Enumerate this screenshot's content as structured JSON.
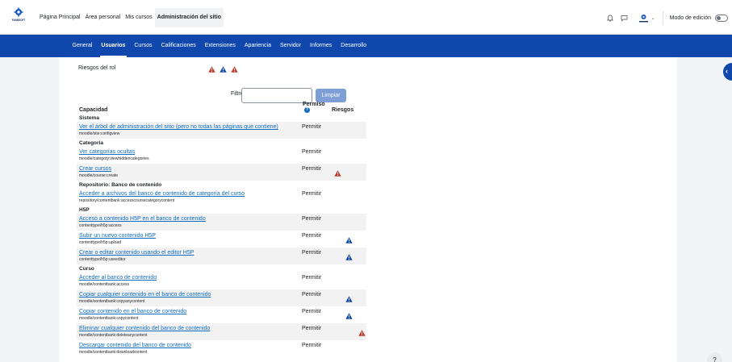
{
  "brand": {
    "logo_text": "FANBSOFT",
    "accent": "#0f47ad"
  },
  "primary_nav": {
    "items": [
      "Página Principal",
      "Área personal",
      "Mis cursos",
      "Administración del sitio"
    ],
    "active_index": 3
  },
  "user_tools": {
    "notifications_icon": "bell-icon",
    "messages_icon": "chat-icon",
    "edit_mode_label": "Modo de edición",
    "edit_mode_on": false
  },
  "secondary_nav": {
    "items": [
      "General",
      "Usuarios",
      "Cursos",
      "Calificaciones",
      "Extensiones",
      "Apariencia",
      "Servidor",
      "Informes",
      "Desarrollo"
    ],
    "active_index": 1
  },
  "risks": {
    "label": "Riesgos del rol"
  },
  "filter": {
    "label": "Filtro",
    "value": "",
    "button_label": "Limpiar"
  },
  "table": {
    "headers": {
      "capability": "Capacidad",
      "permission": "Permiso",
      "risks": "Riesgos"
    },
    "rows": [
      {
        "type": "group",
        "label": "Sistema"
      },
      {
        "type": "cap",
        "name": "Ver el árbol de administración del sitio (pero no todas las páginas que contiene)",
        "key": "moodle/site:configview",
        "permission": "Permitir",
        "risk": ""
      },
      {
        "type": "group",
        "label": "Categoría"
      },
      {
        "type": "cap",
        "name": "Ver categorías ocultas",
        "key": "moodle/category:viewhiddencategories",
        "permission": "Permitir",
        "risk": ""
      },
      {
        "type": "cap",
        "name": "Crear cursos",
        "key": "moodle/course:create",
        "permission": "Permitir",
        "risk": "red"
      },
      {
        "type": "group",
        "label": "Repositorio: Banco de contenido"
      },
      {
        "type": "cap",
        "name": "Acceder a archivos del banco de contenido de categoría del curso",
        "key": "repository/contentbank:accesscoursecategorycontent",
        "permission": "Permitir",
        "risk": ""
      },
      {
        "type": "group",
        "label": "H5P"
      },
      {
        "type": "cap",
        "name": "Acceso a contenido H5P en el banco de contenido",
        "key": "contenttype/h5p:access",
        "permission": "Permitir",
        "risk": ""
      },
      {
        "type": "cap",
        "name": "Subir un nuevo contenido H5P",
        "key": "contenttype/h5p:upload",
        "permission": "Permitir",
        "risk": "blue"
      },
      {
        "type": "cap",
        "name": "Crear o editar contenido usando el editor H5P",
        "key": "contenttype/h5p:useeditor",
        "permission": "Permitir",
        "risk": "blue"
      },
      {
        "type": "group",
        "label": "Curso"
      },
      {
        "type": "cap",
        "name": "Acceder al banco de contenido",
        "key": "moodle/contentbank:access",
        "permission": "Permitir",
        "risk": ""
      },
      {
        "type": "cap",
        "name": "Copiar cualquier contenido en el banco de contenido",
        "key": "moodle/contentbank:copyanycontent",
        "permission": "Permitir",
        "risk": "blue"
      },
      {
        "type": "cap",
        "name": "Copiar contenido en el banco de contenido",
        "key": "moodle/contentbank:copycontent",
        "permission": "Permitir",
        "risk": "blue"
      },
      {
        "type": "cap",
        "name": "Eliminar cualquier contenido del banco de contenido",
        "key": "moodle/contentbank:deleteanycontent",
        "permission": "Permitir",
        "risk": "red2"
      },
      {
        "type": "cap",
        "name": "Descargar contenido del banco de contenido",
        "key": "moodle/contentbank:downloadcontent",
        "permission": "Permitir",
        "risk": ""
      }
    ]
  },
  "colors": {
    "risk_red": "#c0392b",
    "risk_blue": "#0f47ad",
    "link": "#0f6cbf"
  },
  "help_button": "?"
}
